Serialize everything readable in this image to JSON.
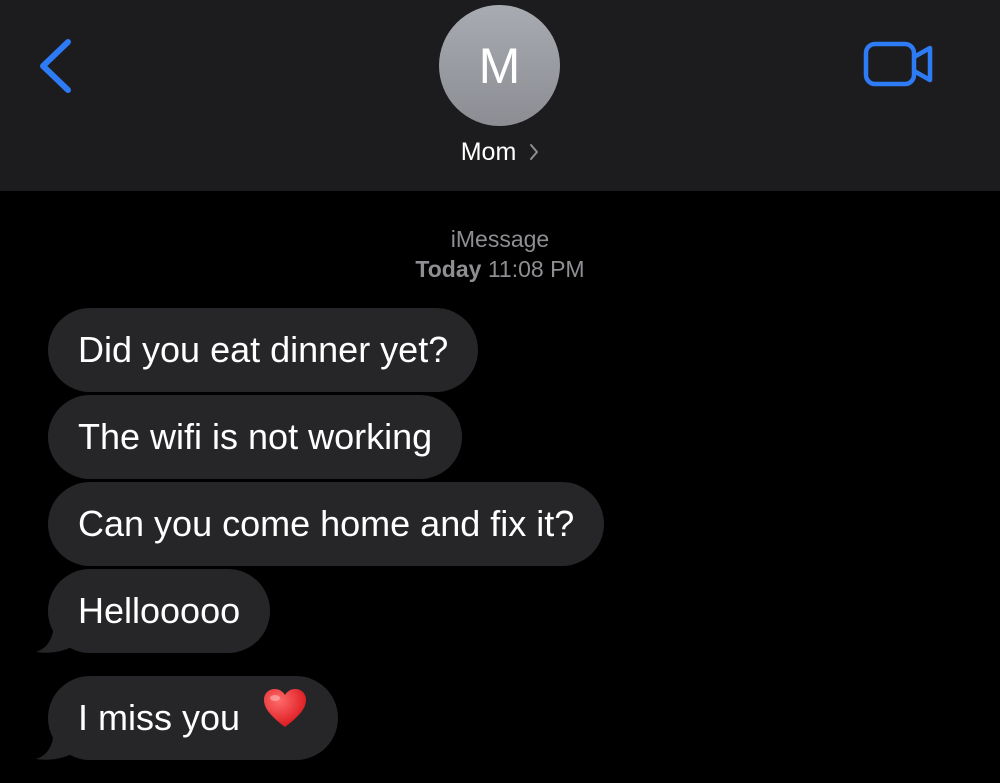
{
  "header": {
    "contact_initial": "M",
    "contact_name": "Mom",
    "back_icon": "chevron-left-icon",
    "video_icon": "video-camera-icon",
    "accent_color": "#2d7cf6"
  },
  "conversation": {
    "service_label": "iMessage",
    "timestamp_day": "Today",
    "timestamp_time": "11:08 PM",
    "messages": [
      {
        "text": "Did you eat dinner yet?",
        "direction": "incoming"
      },
      {
        "text": "The wifi is not working",
        "direction": "incoming"
      },
      {
        "text": "Can you come home and fix it?",
        "direction": "incoming"
      },
      {
        "text": "Hellooooo",
        "direction": "incoming"
      },
      {
        "text": "I miss you",
        "direction": "incoming",
        "emoji": "red-heart-icon"
      }
    ]
  }
}
